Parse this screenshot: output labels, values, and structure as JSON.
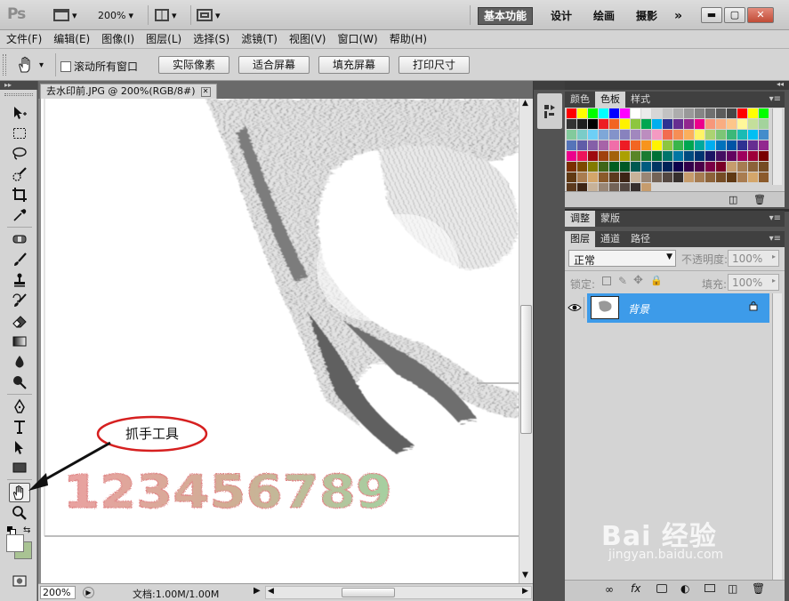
{
  "app": {
    "logo": "Ps",
    "zoom": "200%",
    "workspaces": [
      "基本功能",
      "设计",
      "绘画",
      "摄影"
    ],
    "active_workspace": "基本功能",
    "more": "»"
  },
  "menu": [
    "文件(F)",
    "编辑(E)",
    "图像(I)",
    "图层(L)",
    "选择(S)",
    "滤镜(T)",
    "视图(V)",
    "窗口(W)",
    "帮助(H)"
  ],
  "options": {
    "scroll_all_label": "滚动所有窗口",
    "buttons": [
      "实际像素",
      "适合屏幕",
      "填充屏幕",
      "打印尺寸"
    ]
  },
  "document": {
    "tab_title": "去水印前.JPG @ 200%(RGB/8#)",
    "watermark_digits": "123456789",
    "annotation": "抓手工具"
  },
  "status": {
    "zoom": "200%",
    "doc_size": "文档:1.00M/1.00M"
  },
  "panels": {
    "color_tabs": [
      "颜色",
      "色板",
      "样式"
    ],
    "active_color_tab": "色板",
    "adjust_tabs": [
      "调整",
      "蒙版"
    ],
    "layer_tabs": [
      "图层",
      "通道",
      "路径"
    ],
    "blend_mode": "正常",
    "opacity_label": "不透明度:",
    "opacity_value": "100%",
    "lock_label": "锁定:",
    "fill_label": "填充:",
    "fill_value": "100%",
    "layer_name": "背景"
  },
  "colors": {
    "selected_layer": "#3d9be9",
    "annotation_ellipse": "#d62020"
  },
  "watermark": {
    "source": "Bai 经验",
    "url": "jingyan.baidu.com"
  }
}
